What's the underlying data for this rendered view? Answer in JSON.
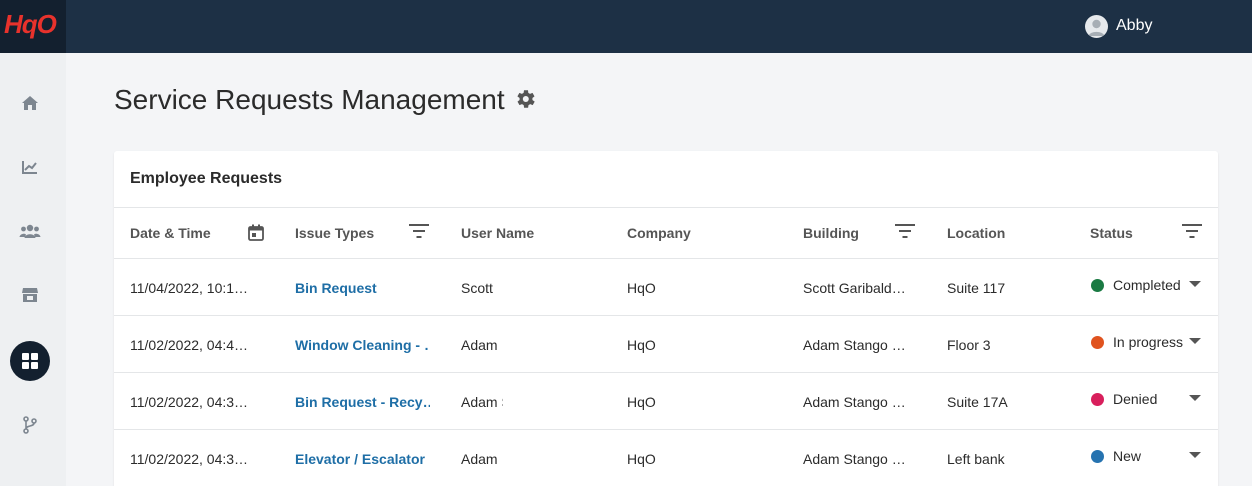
{
  "app": {
    "logo_text": "HqO",
    "user_name": "Abby"
  },
  "page": {
    "title": "Service Requests Management"
  },
  "card": {
    "title": "Employee Requests"
  },
  "columns": {
    "date_time": "Date & Time",
    "issue_types": "Issue Types",
    "user_name": "User Name",
    "company": "Company",
    "building": "Building",
    "location": "Location",
    "status": "Status"
  },
  "rows": [
    {
      "date": "11/04/2022, 10:1…",
      "issue": "Bin Request",
      "user": "Scott",
      "company": "HqO",
      "building": "Scott Garibald…",
      "location": "Suite 117",
      "status": "Completed",
      "status_color": "#1a7a43"
    },
    {
      "date": "11/02/2022, 04:4…",
      "issue": "Window Cleaning - …",
      "user": "Adam",
      "company": "HqO",
      "building": "Adam Stango …",
      "location": "Floor 3",
      "status": "In progress",
      "status_color": "#e0531f"
    },
    {
      "date": "11/02/2022, 04:3…",
      "issue": "Bin Request - Recy…",
      "user": "Adam S",
      "company": "HqO",
      "building": "Adam Stango …",
      "location": "Suite 17A",
      "status": "Denied",
      "status_color": "#d81f5c"
    },
    {
      "date": "11/02/2022, 04:3…",
      "issue": "Elevator / Escalator",
      "user": "Adam",
      "company": "HqO",
      "building": "Adam Stango …",
      "location": "Left bank",
      "status": "New",
      "status_color": "#2673b0"
    }
  ],
  "icons": {
    "nav": [
      "home-icon",
      "analytics-icon",
      "users-icon",
      "store-icon",
      "dashboard-icon",
      "integrations-icon"
    ],
    "header": [
      "calendar-icon",
      "filter-icon",
      "gear-icon",
      "chevron-down-icon"
    ]
  }
}
